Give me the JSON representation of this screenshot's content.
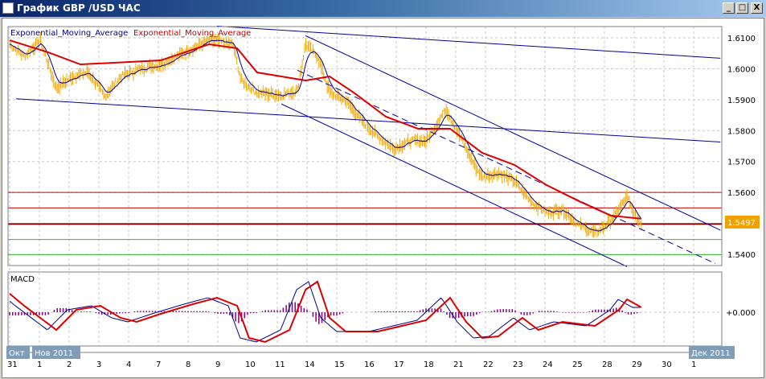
{
  "window": {
    "title": "График GBP /USD  ЧАС",
    "minimize": "_",
    "maximize": "□",
    "close": "X"
  },
  "legend": {
    "ema1": "Exponential_Moving_Average",
    "ema2": "Exponential_Moving_Average",
    "ema1_color": "#00008b",
    "ema2_color": "#cc0000"
  },
  "macd_label": "MACD",
  "macd_zero_label": "+0.000",
  "current_price": "1.5497",
  "month_labels": {
    "oct": "Окт",
    "nov": "Нов 2011",
    "dec": "Дек 2011"
  },
  "chart_data": {
    "type": "line",
    "title": "График GBP /USD  ЧАС",
    "x_ticks": [
      "31",
      "1",
      "2",
      "3",
      "4",
      "7",
      "8",
      "9",
      "10",
      "11",
      "14",
      "15",
      "16",
      "17",
      "18",
      "21",
      "22",
      "23",
      "24",
      "25",
      "28",
      "29",
      "30",
      "1"
    ],
    "y_ticks": [
      "1.6100",
      "1.6000",
      "1.5900",
      "1.5800",
      "1.5700",
      "1.5600",
      "1.5400"
    ],
    "ylim": [
      1.5355,
      1.6138
    ],
    "price": [
      [
        0,
        1.6079
      ],
      [
        0.49,
        1.604
      ],
      [
        1.03,
        1.6092
      ],
      [
        1.57,
        1.5936
      ],
      [
        2.11,
        1.5975
      ],
      [
        2.65,
        1.5988
      ],
      [
        3.19,
        1.591
      ],
      [
        3.73,
        1.5975
      ],
      [
        4.41,
        1.6001
      ],
      [
        5.08,
        1.6014
      ],
      [
        5.89,
        1.6053
      ],
      [
        6.7,
        1.6092
      ],
      [
        7.51,
        1.6079
      ],
      [
        7.78,
        1.5962
      ],
      [
        8.32,
        1.5923
      ],
      [
        9.14,
        1.5915
      ],
      [
        9.68,
        1.5931
      ],
      [
        9.95,
        1.6079
      ],
      [
        10.35,
        1.604
      ],
      [
        10.76,
        1.5923
      ],
      [
        11.3,
        1.5897
      ],
      [
        11.84,
        1.5832
      ],
      [
        12.38,
        1.578
      ],
      [
        12.92,
        1.5741
      ],
      [
        13.46,
        1.5767
      ],
      [
        14.0,
        1.5767
      ],
      [
        14.68,
        1.5871
      ],
      [
        15.08,
        1.5793
      ],
      [
        15.62,
        1.5689
      ],
      [
        15.89,
        1.565
      ],
      [
        16.43,
        1.5663
      ],
      [
        16.97,
        1.5637
      ],
      [
        17.51,
        1.5572
      ],
      [
        18.05,
        1.5533
      ],
      [
        18.59,
        1.5546
      ],
      [
        19.14,
        1.5494
      ],
      [
        19.68,
        1.5468
      ],
      [
        20.22,
        1.5507
      ],
      [
        20.76,
        1.5585
      ],
      [
        21.03,
        1.552
      ],
      [
        21.24,
        1.5499
      ]
    ],
    "ema_slow": [
      [
        0,
        1.6092
      ],
      [
        1.3,
        1.6053
      ],
      [
        2.38,
        1.6014
      ],
      [
        5.08,
        1.6027
      ],
      [
        6.7,
        1.6079
      ],
      [
        7.65,
        1.6066
      ],
      [
        8.32,
        1.5988
      ],
      [
        9.95,
        1.5962
      ],
      [
        10.76,
        1.5975
      ],
      [
        11.57,
        1.5923
      ],
      [
        12.65,
        1.5845
      ],
      [
        13.73,
        1.5806
      ],
      [
        14.81,
        1.5806
      ],
      [
        15.89,
        1.5728
      ],
      [
        16.97,
        1.5689
      ],
      [
        18.05,
        1.5624
      ],
      [
        19.14,
        1.5572
      ],
      [
        20.22,
        1.5525
      ],
      [
        21.24,
        1.5515
      ]
    ],
    "hlines": [
      {
        "price": 1.56,
        "color": "#cc0000"
      },
      {
        "price": 1.555,
        "color": "#cc0000"
      },
      {
        "price": 1.5498,
        "color": "#800000"
      },
      {
        "price": 1.5448,
        "color": "#33bb33"
      },
      {
        "price": 1.5399,
        "color": "#33bb33"
      }
    ],
    "trendlines": [
      {
        "p1": [
          6.97,
          1.6138
        ],
        "p2": [
          23.9,
          1.6034
        ],
        "color": "#0000a0",
        "dash": false
      },
      {
        "p1": [
          0.22,
          1.5903
        ],
        "p2": [
          23.9,
          1.5763
        ],
        "color": "#0000a0",
        "dash": false
      },
      {
        "p1": [
          9.95,
          1.6107
        ],
        "p2": [
          23.9,
          1.5478
        ],
        "color": "#0000a0",
        "dash": false
      },
      {
        "p1": [
          9.14,
          1.5886
        ],
        "p2": [
          20.76,
          1.536
        ],
        "color": "#0000a0",
        "dash": false
      },
      {
        "p1": [
          9.68,
          1.5995
        ],
        "p2": [
          23.73,
          1.537
        ],
        "color": "#0000a0",
        "dash": true
      }
    ],
    "macd_signal": [
      [
        0,
        0.92
      ],
      [
        0.49,
        0.32
      ],
      [
        1.03,
        -0.28
      ],
      [
        1.57,
        -0.88
      ],
      [
        2.24,
        0.12
      ],
      [
        3.05,
        0.32
      ],
      [
        3.73,
        -0.28
      ],
      [
        4.27,
        -0.48
      ],
      [
        5.08,
        -0.08
      ],
      [
        6.16,
        0.4
      ],
      [
        6.97,
        0.72
      ],
      [
        7.65,
        0.32
      ],
      [
        8.05,
        -1.28
      ],
      [
        8.59,
        -1.48
      ],
      [
        9.41,
        -0.88
      ],
      [
        9.95,
        1.12
      ],
      [
        10.35,
        1.52
      ],
      [
        10.76,
        -0.28
      ],
      [
        11.3,
        -0.96
      ],
      [
        12.38,
        -0.96
      ],
      [
        13.19,
        -0.68
      ],
      [
        14.0,
        -0.4
      ],
      [
        14.81,
        0.72
      ],
      [
        15.35,
        -0.48
      ],
      [
        15.89,
        -1.28
      ],
      [
        16.43,
        -1.2
      ],
      [
        17.24,
        -0.28
      ],
      [
        17.78,
        -0.88
      ],
      [
        18.59,
        -0.48
      ],
      [
        19.68,
        -0.68
      ],
      [
        20.49,
        0.12
      ],
      [
        20.76,
        0.64
      ],
      [
        21.24,
        0.24
      ]
    ],
    "macd_units": "x0.001"
  }
}
